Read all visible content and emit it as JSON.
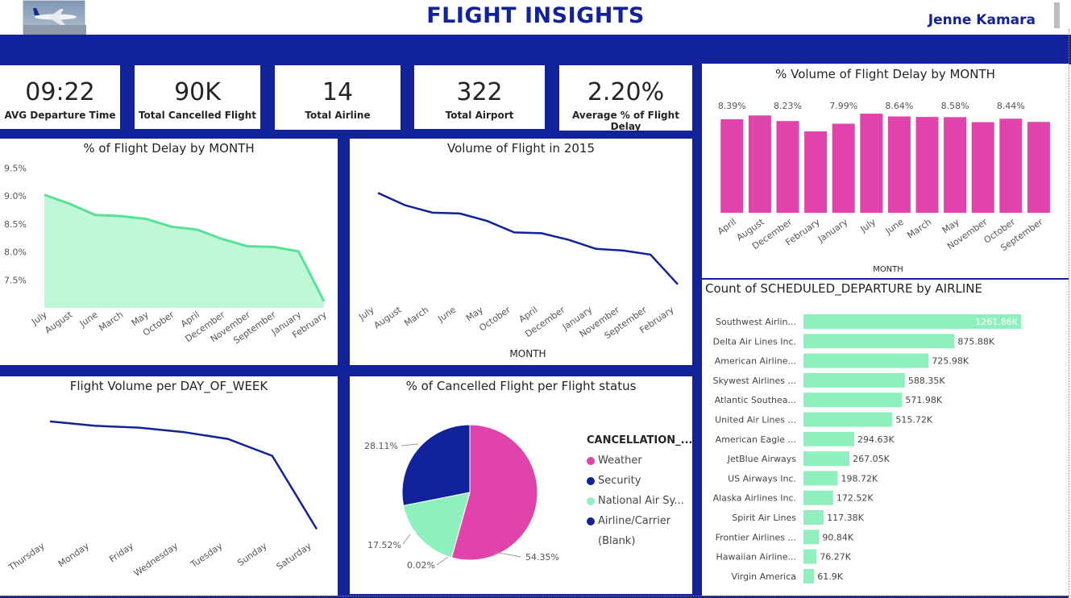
{
  "header": {
    "title": "FLIGHT INSIGHTS",
    "author": "Jenne Kamara"
  },
  "kpis": [
    {
      "value": "09:22",
      "label": "AVG Departure Time"
    },
    {
      "value": "90K",
      "label": "Total Cancelled Flight"
    },
    {
      "value": "14",
      "label": "Total Airline"
    },
    {
      "value": "322",
      "label": "Total Airport"
    },
    {
      "value": "2.20%",
      "label": "Average % of Flight Delay"
    }
  ],
  "colors": {
    "navy": "#11229a",
    "mint": "#8ff0be",
    "mint_fill": "#bff7d9",
    "mint_line": "#57e294",
    "pink": "#e044ab"
  },
  "chart_data": [
    {
      "id": "delay_by_month",
      "type": "area",
      "title": "% of Flight Delay by MONTH",
      "categories": [
        "July",
        "August",
        "June",
        "March",
        "May",
        "October",
        "April",
        "December",
        "November",
        "September",
        "January",
        "February"
      ],
      "values": [
        9.02,
        8.86,
        8.66,
        8.64,
        8.59,
        8.45,
        8.4,
        8.23,
        8.1,
        8.09,
        8.01,
        7.12
      ],
      "yticks": [
        "9.5%",
        "9.0%",
        "8.5%",
        "8.0%",
        "7.5%"
      ],
      "ytick_values": [
        9.5,
        9.0,
        8.5,
        8.0,
        7.5
      ],
      "ylim": [
        7.0,
        9.65
      ]
    },
    {
      "id": "volume_2015",
      "type": "line",
      "title": "Volume of Flight in 2015",
      "xlabel": "MONTH",
      "categories": [
        "July",
        "August",
        "March",
        "June",
        "May",
        "October",
        "April",
        "December",
        "January",
        "November",
        "September",
        "February"
      ],
      "values": [
        521,
        506,
        497,
        496,
        487,
        473,
        472,
        464,
        453,
        451,
        446,
        410
      ],
      "ylim": [
        395,
        540
      ]
    },
    {
      "id": "volume_pct_delay",
      "type": "bar",
      "title": "% Volume of Flight Delay by MONTH",
      "xlabel": "MONTH",
      "categories": [
        "April",
        "August",
        "December",
        "February",
        "January",
        "July",
        "June",
        "March",
        "May",
        "November",
        "October",
        "September"
      ],
      "values": [
        8.39,
        8.73,
        8.23,
        7.3,
        7.99,
        8.89,
        8.64,
        8.6,
        8.58,
        8.13,
        8.44,
        8.15
      ],
      "labels": [
        "8.39%",
        "",
        "8.23%",
        "",
        "7.99%",
        "",
        "8.64%",
        "",
        "8.58%",
        "",
        "8.44%",
        ""
      ],
      "ylim": [
        0,
        9.4
      ]
    },
    {
      "id": "scheduled_by_airline",
      "type": "bar",
      "orientation": "horizontal",
      "title": "Count of SCHEDULED_DEPARTURE by AIRLINE",
      "categories": [
        "Southwest Airlin...",
        "Delta Air Lines Inc.",
        "American Airline...",
        "Skywest Airlines ...",
        "Atlantic Southea...",
        "United Air Lines ...",
        "American Eagle ...",
        "JetBlue Airways",
        "US Airways Inc.",
        "Alaska Airlines Inc.",
        "Spirit Air Lines",
        "Frontier Airlines ...",
        "Hawaiian Airline...",
        "Virgin America"
      ],
      "values": [
        1261.86,
        875.88,
        725.98,
        588.35,
        571.98,
        515.72,
        294.63,
        267.05,
        198.72,
        172.52,
        117.38,
        90.84,
        76.27,
        61.9
      ],
      "labels": [
        "1261.86K",
        "875.88K",
        "725.98K",
        "588.35K",
        "571.98K",
        "515.72K",
        "294.63K",
        "267.05K",
        "198.72K",
        "172.52K",
        "117.38K",
        "90.84K",
        "76.27K",
        "61.9K"
      ]
    },
    {
      "id": "volume_per_dow",
      "type": "line",
      "title": "Flight Volume per DAY_OF_WEEK",
      "categories": [
        "Thursday",
        "Monday",
        "Friday",
        "Wednesday",
        "Tuesday",
        "Sunday",
        "Saturday"
      ],
      "values": [
        872,
        865,
        862,
        855,
        844,
        817,
        700
      ],
      "ylim": [
        680,
        895
      ]
    },
    {
      "id": "cancelled_status",
      "type": "pie",
      "title": "% of Cancelled Flight per Flight status",
      "legend_title": "CANCELLATION_...",
      "legend": [
        {
          "name": "Weather",
          "color": "#e044ab"
        },
        {
          "name": "Security",
          "color": "#11229a"
        },
        {
          "name": "National Air Sy...",
          "color": "#8ff0be"
        },
        {
          "name": "Airline/Carrier",
          "color": "#11229a"
        },
        {
          "name": "(Blank)",
          "color": ""
        }
      ],
      "slices": [
        {
          "name": "Weather",
          "value": 54.35,
          "label": "54.35%",
          "color": "#e044ab"
        },
        {
          "name": "Security",
          "value": 0.02,
          "label": "0.02%",
          "color": "#6b46a6"
        },
        {
          "name": "National Air Sy...",
          "value": 17.52,
          "label": "17.52%",
          "color": "#8ff0be"
        },
        {
          "name": "Airline/Carrier",
          "value": 28.11,
          "label": "28.11%",
          "color": "#11229a"
        }
      ]
    }
  ]
}
